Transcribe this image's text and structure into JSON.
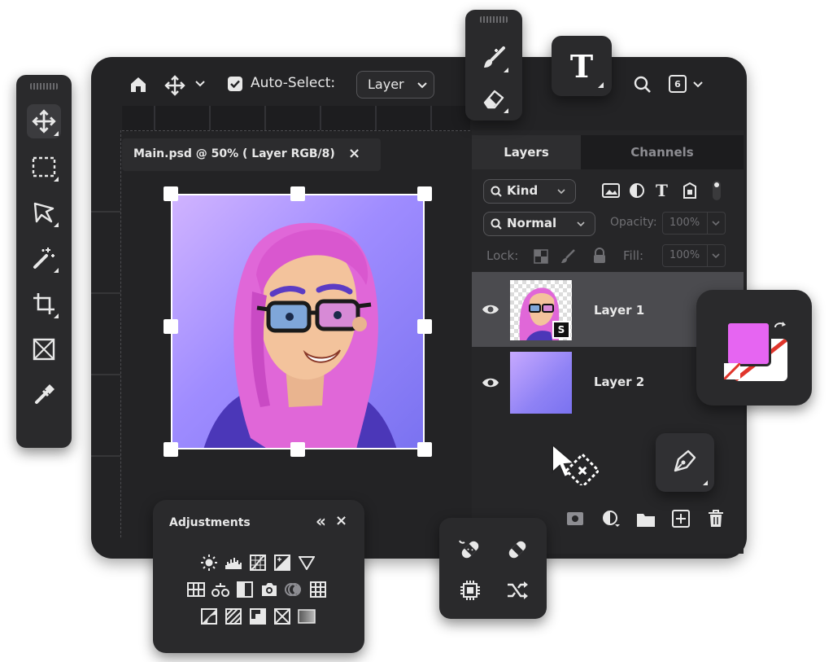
{
  "options_bar": {
    "auto_select_label": "Auto-Select:",
    "auto_select_checked": true,
    "target_value": "Layer",
    "view_value": "6"
  },
  "document": {
    "tab_title": "Main.psd @ 50% ( Layer RGB/8)",
    "close_glyph": "×"
  },
  "panel_tabs": {
    "layers": "Layers",
    "channels": "Channels"
  },
  "layers_filters": {
    "kind_label": "Kind",
    "blend_mode": "Normal",
    "opacity_label": "Opacity:",
    "opacity_value": "100%",
    "lock_label": "Lock:",
    "fill_label": "Fill:",
    "fill_value": "100%"
  },
  "layers": [
    {
      "name": "Layer 1",
      "selected": true
    },
    {
      "name": "Layer 2",
      "selected": false
    }
  ],
  "adjustments": {
    "title": "Adjustments",
    "collapse_glyph": "«",
    "close_glyph": "×"
  },
  "colors": {
    "accent_pink": "#e665f2",
    "canvas_top": "#c2a6ff",
    "canvas_bottom": "#7d75f0",
    "panel_bg": "#232325"
  },
  "icons": [
    "home-icon",
    "move-icon",
    "zoom-icon",
    "marquee-icon",
    "lasso-icon",
    "magic-wand-icon",
    "crop-icon",
    "frame-icon",
    "eyedropper-icon",
    "brush-icon",
    "eraser-icon",
    "text-icon",
    "pen-icon",
    "eye-icon",
    "trash-icon",
    "new-layer-icon",
    "folder-icon",
    "mask-icon",
    "adjustment-layer-icon",
    "swap-colors-icon",
    "healing-icon",
    "bandage-icon",
    "chip-icon",
    "shuffle-icon"
  ]
}
